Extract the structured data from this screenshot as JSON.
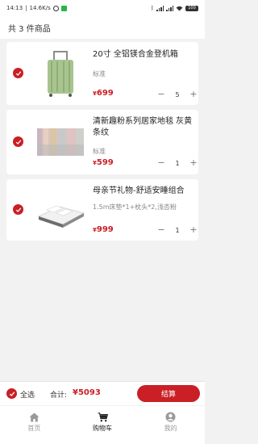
{
  "status_bar": {
    "time": "14:13",
    "net_speed": "14.6K/s",
    "battery": "100"
  },
  "header": {
    "title": "共 3 件商品"
  },
  "products": [
    {
      "name": "20寸 全铝镁合金登机箱",
      "spec": "标准",
      "currency": "¥",
      "price": "699",
      "quantity": "5",
      "selected": true
    },
    {
      "name": "清新趣粉系列居家地毯 灰黄条纹",
      "spec": "标准",
      "currency": "¥",
      "price": "599",
      "quantity": "1",
      "selected": true
    },
    {
      "name": "母亲节礼物-舒适安睡组合",
      "spec": "1.5m床垫*1+枕头*2,浅杏粉",
      "currency": "¥",
      "price": "999",
      "quantity": "1",
      "selected": true
    }
  ],
  "stepper": {
    "minus": "−",
    "plus": "+"
  },
  "bottom_bar": {
    "select_all_label": "全选",
    "total_label": "合计:",
    "total_value": "¥5093",
    "checkout_label": "结算"
  },
  "tabbar": {
    "items": [
      {
        "label": "首页",
        "icon": "home-icon",
        "active": false
      },
      {
        "label": "购物车",
        "icon": "cart-icon",
        "active": true
      },
      {
        "label": "我的",
        "icon": "user-icon",
        "active": false
      }
    ]
  },
  "colors": {
    "accent": "#c91f25",
    "background": "#f2f2f2"
  }
}
